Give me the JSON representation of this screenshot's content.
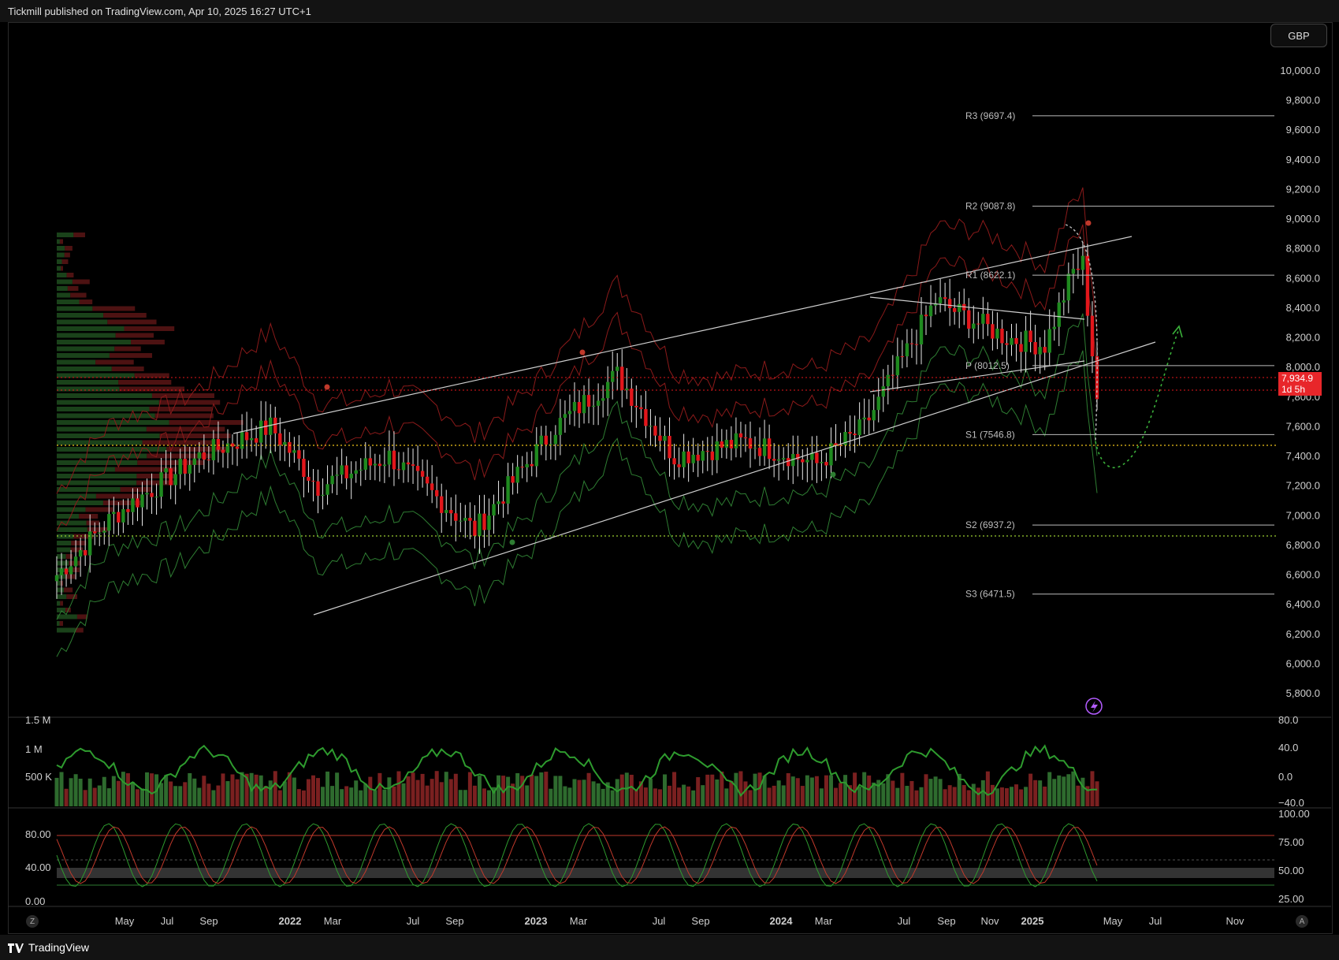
{
  "header": {
    "published_text": "Tickmill published on TradingView.com, Apr 10, 2025 16:27 UTC+1"
  },
  "currency_button": "GBP",
  "price_axis": {
    "labels": [
      "10,000.0",
      "9,800.0",
      "9,600.0",
      "9,400.0",
      "9,200.0",
      "9,000.0",
      "8,800.0",
      "8,600.0",
      "8,400.0",
      "8,200.0",
      "8,000.0",
      "7,800.0",
      "7,600.0",
      "7,400.0",
      "7,200.0",
      "7,000.0",
      "6,800.0",
      "6,600.0",
      "6,400.0",
      "6,200.0",
      "6,000.0",
      "5,800.0"
    ]
  },
  "current_price": {
    "value": "7,934.9",
    "countdown": "1d 5h"
  },
  "pivots": [
    {
      "label": "R3 (9697.4)",
      "value": 9697.4
    },
    {
      "label": "R2 (9087.8)",
      "value": 9087.8
    },
    {
      "label": "R1 (8622.1)",
      "value": 8622.1
    },
    {
      "label": "P (8012.5)",
      "value": 8012.5
    },
    {
      "label": "S1 (7546.8)",
      "value": 7546.8
    },
    {
      "label": "S2 (6937.2)",
      "value": 6937.2
    },
    {
      "label": "S3 (6471.5)",
      "value": 6471.5
    }
  ],
  "time_axis": {
    "labels": [
      "May",
      "Jul",
      "Sep",
      "2022",
      "Mar",
      "Jul",
      "Sep",
      "2023",
      "Mar",
      "Jul",
      "Sep",
      "2024",
      "Mar",
      "Jul",
      "Sep",
      "Nov",
      "2025",
      "May",
      "Jul",
      "Nov"
    ],
    "bold": [
      "2022",
      "2023",
      "2024",
      "2025"
    ]
  },
  "volume_pane": {
    "left_labels": [
      "1.5 M",
      "1 M",
      "500 K"
    ],
    "right_labels": [
      "80.0",
      "40.0",
      "0.0",
      "−40.0"
    ]
  },
  "stoch_pane": {
    "left_labels": [
      "80.00",
      "40.00",
      "0.00"
    ],
    "right_labels": [
      "100.00",
      "75.00",
      "50.00",
      "25.00"
    ]
  },
  "corner_left": "Z",
  "corner_right": "A",
  "footer": {
    "brand": "TradingView"
  },
  "colors": {
    "up": "#1f8a1f",
    "down": "#e3161b",
    "band": "#8b1a1a",
    "band_green": "#2e7d32",
    "line": "#cfcfcf"
  },
  "icons": [
    "lightning-icon",
    "tradingview-logo-icon"
  ],
  "chart_data": {
    "type": "candlestick",
    "symbol_currency": "GBP",
    "yrange": [
      5700,
      10100
    ],
    "last_price": 7934.9,
    "pivot_levels": {
      "R3": 9697.4,
      "R2": 9087.8,
      "R1": 8622.1,
      "P": 8012.5,
      "S1": 7546.8,
      "S2": 6937.2,
      "S3": 6471.5
    },
    "volume_axis": [
      "500 K",
      "1 M",
      "1.5 M"
    ],
    "oscillator_axis": [
      -40,
      0,
      40,
      80
    ],
    "stoch_axis": [
      0,
      40,
      80
    ]
  }
}
